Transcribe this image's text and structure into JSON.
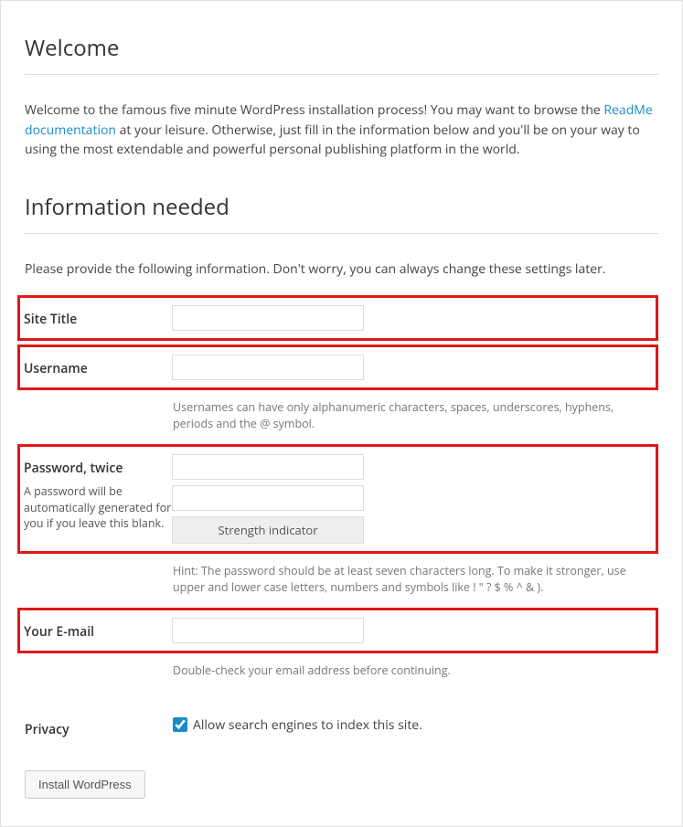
{
  "heading_welcome": "Welcome",
  "intro_part1": "Welcome to the famous five minute WordPress installation process! You may want to browse the ",
  "intro_link": "ReadMe documentation",
  "intro_part2": " at your leisure. Otherwise, just fill in the information below and you'll be on your way to using the most extendable and powerful personal publishing platform in the world.",
  "heading_info": "Information needed",
  "info_subtext": "Please provide the following information. Don't worry, you can always change these settings later.",
  "fields": {
    "site_title": {
      "label": "Site Title",
      "value": ""
    },
    "username": {
      "label": "Username",
      "value": "",
      "desc": "Usernames can have only alphanumeric characters, spaces, underscores, hyphens, periods and the @ symbol."
    },
    "password": {
      "label": "Password, twice",
      "subhint": "A password will be automatically generated for you if you leave this blank.",
      "value1": "",
      "value2": "",
      "strength_label": "Strength indicator",
      "hint": "Hint: The password should be at least seven characters long. To make it stronger, use upper and lower case letters, numbers and symbols like ! \" ? $ % ^ & )."
    },
    "email": {
      "label": "Your E-mail",
      "value": "",
      "desc": "Double-check your email address before continuing."
    },
    "privacy": {
      "label": "Privacy",
      "checkbox_label": "Allow search engines to index this site.",
      "checked": true
    }
  },
  "submit_label": "Install WordPress"
}
